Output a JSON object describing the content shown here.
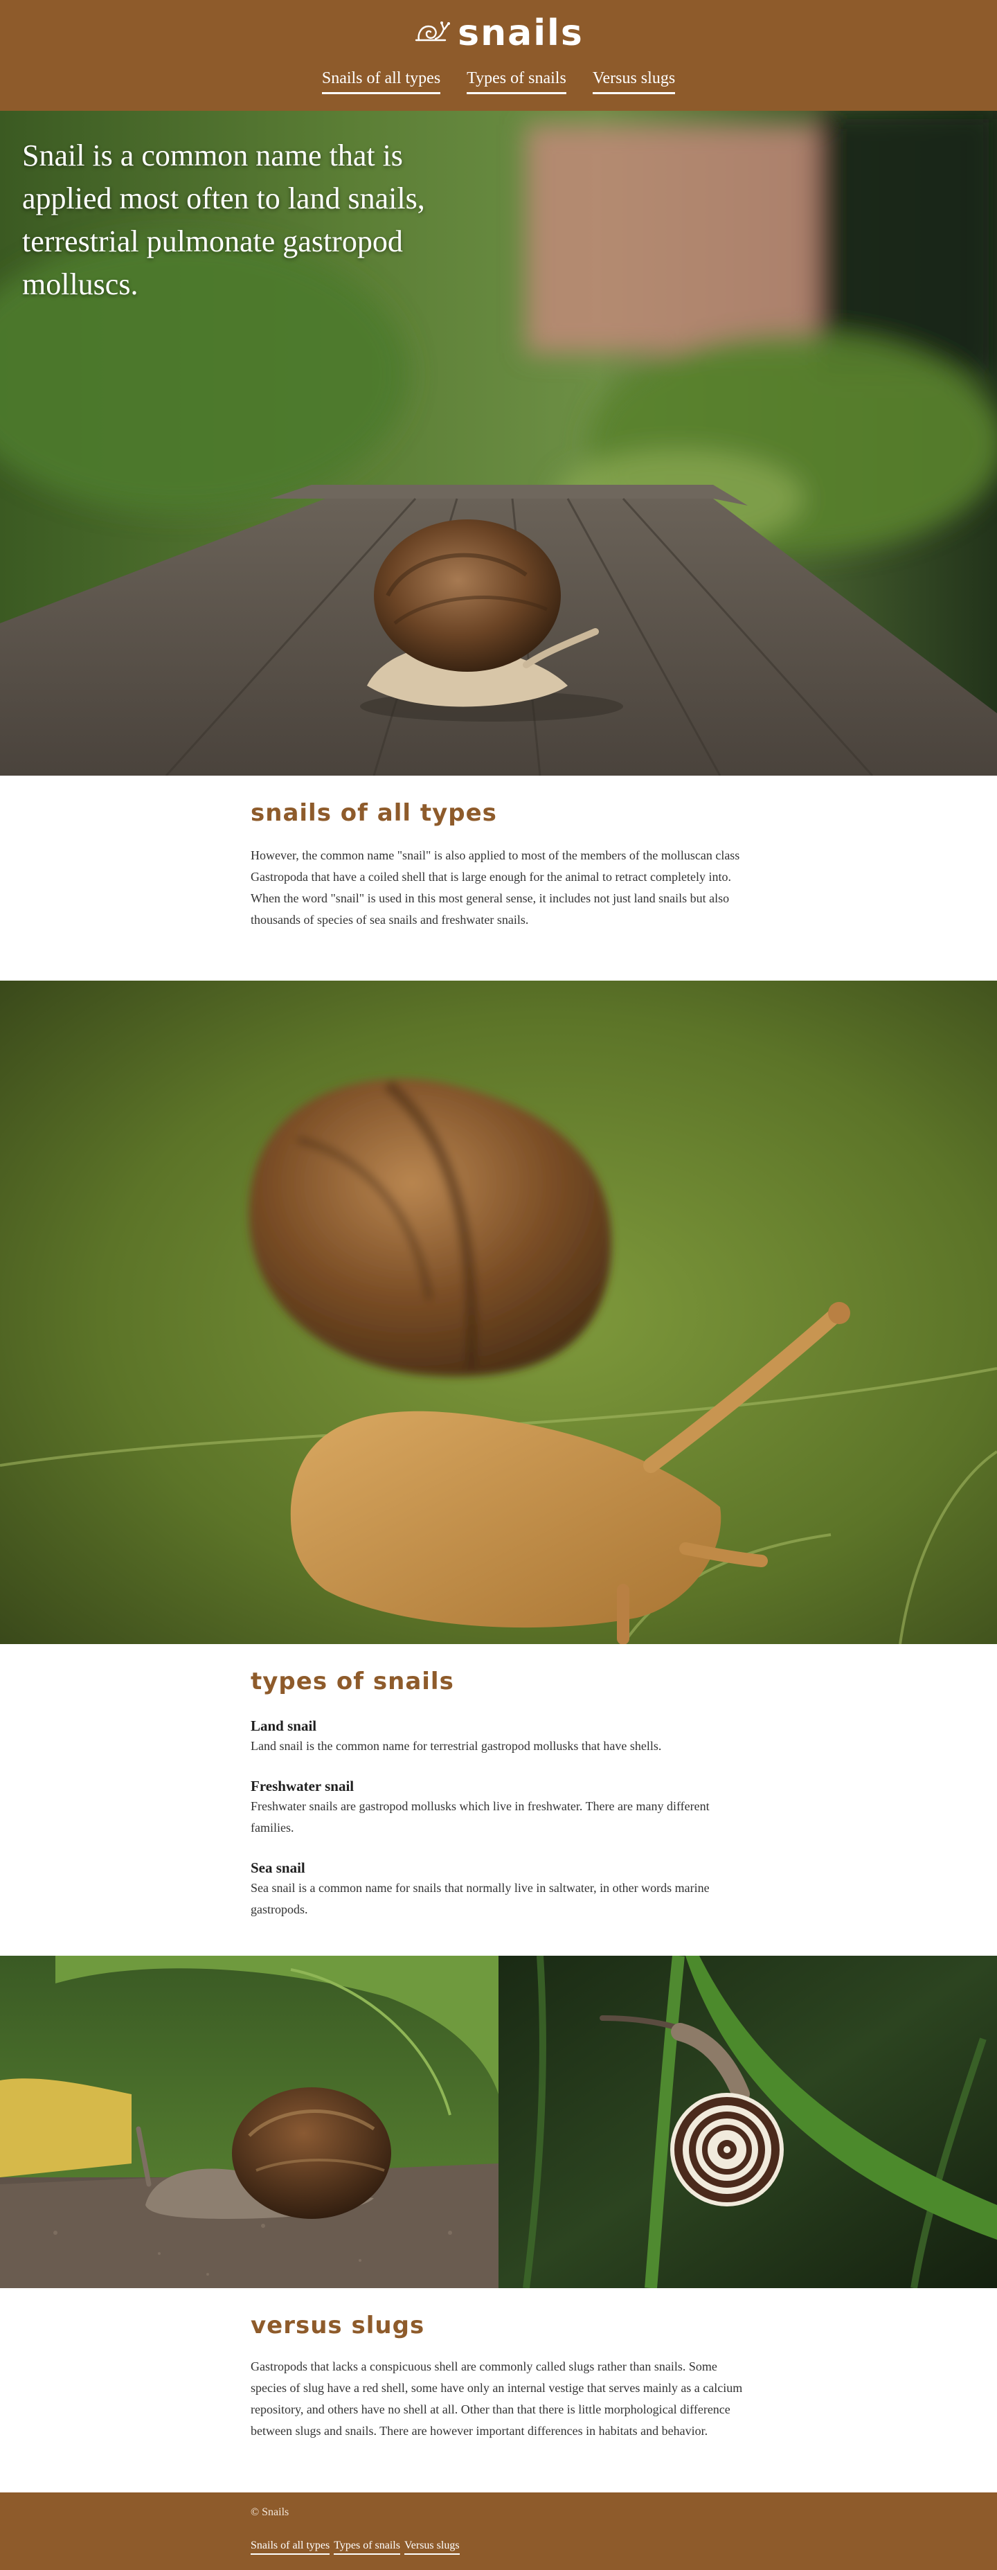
{
  "header": {
    "logo_text": "snails",
    "nav": [
      {
        "label": "Snails of all types"
      },
      {
        "label": "Types of snails"
      },
      {
        "label": "Versus slugs"
      }
    ]
  },
  "hero": {
    "tagline": "Snail is a common name that is applied most often to land snails, terrestrial pulmonate gastropod molluscs."
  },
  "section_all_types": {
    "heading": "Snails of all types",
    "body": "However, the common name \"snail\" is also applied to most of the members of the molluscan class Gastropoda that have a coiled shell that is large enough for the animal to retract completely into. When the word \"snail\" is used in this most general sense, it includes not just land snails but also thousands of species of sea snails and freshwater snails."
  },
  "section_types": {
    "heading": "Types of snails",
    "items": [
      {
        "title": "Land snail",
        "text": "Land snail is the common name for terrestrial gastropod mollusks that have shells."
      },
      {
        "title": "Freshwater snail",
        "text": "Freshwater snails are gastropod mollusks which live in freshwater. There are many different families."
      },
      {
        "title": "Sea snail",
        "text": "Sea snail is a common name for snails that normally live in saltwater, in other words marine gastropods."
      }
    ]
  },
  "section_slugs": {
    "heading": "Versus slugs",
    "body": "Gastropods that lacks a conspicuous shell are commonly called slugs rather than snails. Some species of slug have a red shell, some have only an internal vestige that serves mainly as a calcium repository, and others have no shell at all. Other than that there is little morphological difference between slugs and snails. There are however important differences in habitats and behavior."
  },
  "footer": {
    "copyright": "© Snails",
    "nav": [
      {
        "label": "Snails of all types"
      },
      {
        "label": "Types of snails"
      },
      {
        "label": "Versus slugs"
      }
    ]
  },
  "colors": {
    "brand": "#8e5b2b",
    "text": "#333333",
    "background": "#ffffff"
  }
}
